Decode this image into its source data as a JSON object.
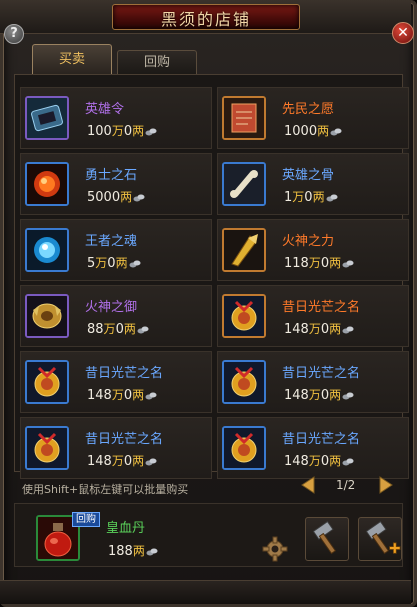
{
  "window": {
    "title": "黑须的店铺",
    "help_label": "?",
    "close_label": "✕"
  },
  "tabs": [
    {
      "label": "买卖",
      "active": true
    },
    {
      "label": "回购",
      "active": false
    }
  ],
  "currency": {
    "wan": "万",
    "liang": "两",
    "coin_icon": "silver-coin-icon"
  },
  "items": [
    {
      "name": "英雄令",
      "color": "purple",
      "price": [
        {
          "n": "100",
          "u": "万"
        },
        {
          "n": "0",
          "u": "两"
        }
      ],
      "icon": "hero-token-icon"
    },
    {
      "name": "先民之愿",
      "color": "orange",
      "price": [
        {
          "n": "1000",
          "u": "两"
        }
      ],
      "icon": "ancestor-scroll-icon"
    },
    {
      "name": "勇士之石",
      "color": "blue",
      "price": [
        {
          "n": "5000",
          "u": "两"
        }
      ],
      "icon": "warrior-stone-icon"
    },
    {
      "name": "英雄之骨",
      "color": "blue",
      "price": [
        {
          "n": "1",
          "u": "万"
        },
        {
          "n": "0",
          "u": "两"
        }
      ],
      "icon": "hero-bone-icon"
    },
    {
      "name": "王者之魂",
      "color": "blue",
      "price": [
        {
          "n": "5",
          "u": "万"
        },
        {
          "n": "0",
          "u": "两"
        }
      ],
      "icon": "king-soul-icon"
    },
    {
      "name": "火神之力",
      "color": "orange",
      "price": [
        {
          "n": "118",
          "u": "万"
        },
        {
          "n": "0",
          "u": "两"
        }
      ],
      "icon": "fire-god-power-icon"
    },
    {
      "name": "火神之御",
      "color": "purple",
      "price": [
        {
          "n": "88",
          "u": "万"
        },
        {
          "n": "0",
          "u": "两"
        }
      ],
      "icon": "fire-god-guard-icon"
    },
    {
      "name": "昔日光芒之名",
      "color": "orange",
      "price": [
        {
          "n": "148",
          "u": "万"
        },
        {
          "n": "0",
          "u": "两"
        }
      ],
      "icon": "past-glory-medal-icon"
    },
    {
      "name": "昔日光芒之名",
      "color": "blue",
      "price": [
        {
          "n": "148",
          "u": "万"
        },
        {
          "n": "0",
          "u": "两"
        }
      ],
      "icon": "past-glory-medal-icon"
    },
    {
      "name": "昔日光芒之名",
      "color": "blue",
      "price": [
        {
          "n": "148",
          "u": "万"
        },
        {
          "n": "0",
          "u": "两"
        }
      ],
      "icon": "past-glory-medal-icon"
    },
    {
      "name": "昔日光芒之名",
      "color": "blue",
      "price": [
        {
          "n": "148",
          "u": "万"
        },
        {
          "n": "0",
          "u": "两"
        }
      ],
      "icon": "past-glory-medal-icon"
    },
    {
      "name": "昔日光芒之名",
      "color": "blue",
      "price": [
        {
          "n": "148",
          "u": "万"
        },
        {
          "n": "0",
          "u": "两"
        }
      ],
      "icon": "past-glory-medal-icon"
    }
  ],
  "hint": "使用Shift+鼠标左键可以批量购买",
  "pager": {
    "text": "1/2"
  },
  "buyback": {
    "badge": "回购",
    "name": "皇血丹",
    "price_number": "188",
    "price_unit": "两",
    "icon": "red-potion-icon"
  },
  "tools": [
    {
      "icon": "settings-gear-icon"
    },
    {
      "icon": "repair-hammer-icon"
    },
    {
      "icon": "repair-all-hammer-icon"
    }
  ]
}
